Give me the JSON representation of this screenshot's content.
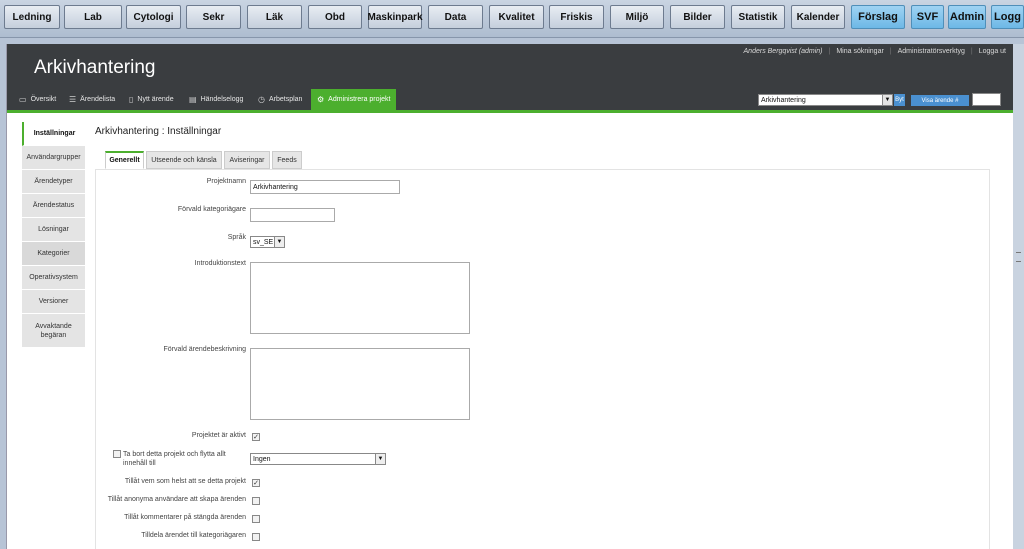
{
  "topnav": [
    "Ledning",
    "Lab",
    "Cytologi",
    "Sekr",
    "Läk",
    "Obd",
    "Maskinpark",
    "Data",
    "Kvalitet",
    "Friskis",
    "Miljö",
    "Bilder",
    "Statistik",
    "Kalender",
    "Förslag",
    "SVF",
    "Admin",
    "Logg"
  ],
  "header": {
    "title": "Arkivhantering",
    "user": "Anders Bergqvist (admin)",
    "links": [
      "Mina sökningar",
      "Administratörsverktyg",
      "Logga ut"
    ]
  },
  "menu": [
    {
      "label": "Översikt",
      "icon": "overview-icon"
    },
    {
      "label": "Ärendelista",
      "icon": "list-icon"
    },
    {
      "label": "Nytt ärende",
      "icon": "new-issue-icon"
    },
    {
      "label": "Händelselogg",
      "icon": "log-icon"
    },
    {
      "label": "Arbetsplan",
      "icon": "clock-icon"
    },
    {
      "label": "Administrera projekt",
      "icon": "gear-icon"
    }
  ],
  "project_select": {
    "value": "Arkivhantering",
    "byt_label": "Byt",
    "visa_label": "Visa ärende #",
    "visa_value": ""
  },
  "sidenav": [
    "Inställningar",
    "Användargrupper",
    "Ärendetyper",
    "Ärendestatus",
    "Lösningar",
    "Kategorier",
    "Operativsystem",
    "Versioner",
    "Avvaktande begäran"
  ],
  "page_title": "Arkivhantering : Inställningar",
  "tabs": [
    "Generellt",
    "Utseende och känsla",
    "Aviseringar",
    "Feeds"
  ],
  "form": {
    "projektnamn_label": "Projektnamn",
    "projektnamn_value": "Arkivhantering",
    "kategoriagare_label": "Förvald kategoriägare",
    "kategoriagare_value": "",
    "sprak_label": "Språk",
    "sprak_value": "sv_SE",
    "intro_label": "Introduktionstext",
    "beskrivning_label": "Förvald ärendebeskrivning",
    "aktivt_label": "Projektet är aktivt",
    "tabort_label": "Ta bort detta projekt och flytta allt innehåll till",
    "tabort_value": "Ingen",
    "vemsomhelst_label": "Tillåt vem som helst att se detta projekt",
    "anonyma_label": "Tillåt anonyma användare att skapa ärenden",
    "kommentarer_label": "Tillåt kommentarer på stängda ärenden",
    "tilldela_label": "Tilldela ärendet till kategoriägaren"
  },
  "checks": {
    "aktivt": true,
    "tabort": false,
    "vemsomhelst": true,
    "anonyma": false,
    "kommentarer": false,
    "tilldela": false
  },
  "colors": {
    "accent_green": "#4caf2e",
    "header_dark": "#3a3d40",
    "button_blue": "#4a90d0",
    "highlight_blue": "#6db8e6"
  }
}
